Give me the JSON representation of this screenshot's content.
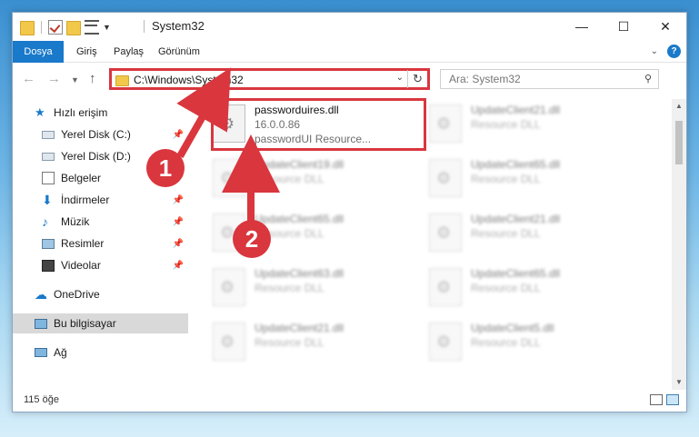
{
  "window": {
    "title": "System32",
    "controls": {
      "minimize": "—",
      "maximize": "☐",
      "close": "✕"
    }
  },
  "ribbon": {
    "tabs": [
      "Dosya",
      "Giriş",
      "Paylaş",
      "Görünüm"
    ],
    "active_tab": "Dosya",
    "accent": "#1979ca"
  },
  "address": {
    "path": "C:\\Windows\\System32",
    "refresh_glyph": "↻"
  },
  "search": {
    "placeholder": "Ara: System32"
  },
  "nav": {
    "items": [
      {
        "label": "Hızlı erişim",
        "icon": "star-icon"
      },
      {
        "label": "Yerel Disk (C:)",
        "icon": "drive-icon",
        "pinned": true
      },
      {
        "label": "Yerel Disk (D:)",
        "icon": "drive-icon"
      },
      {
        "label": "Belgeler",
        "icon": "documents-icon",
        "pinned": true
      },
      {
        "label": "İndirmeler",
        "icon": "download-icon",
        "pinned": true
      },
      {
        "label": "Müzik",
        "icon": "music-icon",
        "pinned": true
      },
      {
        "label": "Resimler",
        "icon": "pictures-icon",
        "pinned": true
      },
      {
        "label": "Videolar",
        "icon": "videos-icon",
        "pinned": true
      },
      {
        "label": "OneDrive",
        "icon": "cloud-icon"
      },
      {
        "label": "Bu bilgisayar",
        "icon": "computer-icon",
        "selected": true
      },
      {
        "label": "Ağ",
        "icon": "network-icon"
      }
    ]
  },
  "files": {
    "highlighted": {
      "name": "passworduires.dll",
      "version": "16.0.0.86",
      "description": "passwordUI Resource..."
    },
    "blurred": [
      {
        "name": "UpdateClient21.dll",
        "description": "Resource DLL"
      },
      {
        "name": "UpdateClient19.dll",
        "description": "Resource DLL"
      },
      {
        "name": "UpdateClient65.dll",
        "description": "Resource DLL"
      },
      {
        "name": "UpdateClient65.dll",
        "description": "Resource DLL"
      },
      {
        "name": "UpdateClient21.dll",
        "description": "Resource DLL"
      },
      {
        "name": "UpdateClient63.dll",
        "description": "Resource DLL"
      },
      {
        "name": "UpdateClient65.dll",
        "description": "Resource DLL"
      },
      {
        "name": "UpdateClient21.dll",
        "description": "Resource DLL"
      },
      {
        "name": "UpdateClient5.dll",
        "description": "Resource DLL"
      }
    ]
  },
  "status": {
    "count": "115 öğe"
  },
  "callouts": {
    "one": "1",
    "two": "2",
    "color": "#d9363e"
  }
}
